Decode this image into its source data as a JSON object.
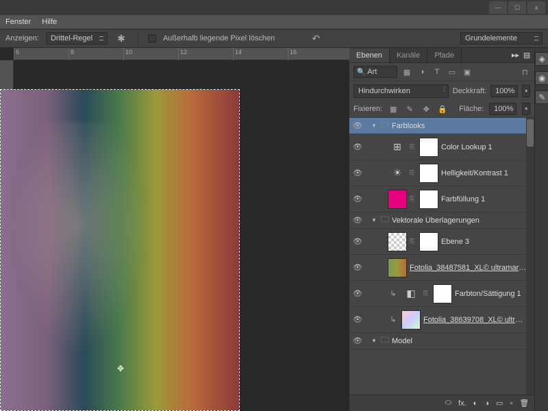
{
  "menubar": {
    "fenster": "Fenster",
    "hilfe": "Hilfe"
  },
  "winbtns": {
    "min": "—",
    "max": "☐",
    "close": "x"
  },
  "optbar": {
    "anzeigen_label": "Anzeigen:",
    "anzeigen_value": "Drittel-Regel",
    "checkbox_label": "Außerhalb liegende Pixel löschen",
    "workspace_dd": "Grundelemente"
  },
  "ruler": {
    "ticks": [
      "6",
      "8",
      "10",
      "12",
      "14",
      "16"
    ]
  },
  "panels": {
    "tabs": {
      "ebenen": "Ebenen",
      "kanaele": "Kanäle",
      "pfade": "Pfade"
    },
    "search": "Art",
    "blend_mode": "Hindurchwirken",
    "deckkraft_label": "Deckkraft:",
    "deckkraft_value": "100%",
    "fixieren_label": "Fixieren:",
    "flaeche_label": "Fläche:",
    "flaeche_value": "100%"
  },
  "groups": {
    "farblooks": "Farblooks",
    "vektorale": "Vektorale Überlagerungen",
    "model": "Model"
  },
  "layers": {
    "color_lookup": "Color Lookup 1",
    "hellkontrast": "Helligkeit/Kontrast 1",
    "farbfuellung": "Farbfüllung 1",
    "ebene3": "Ebene 3",
    "fotolia1": "Fotolia_38487581_XL© ultramari...",
    "farbton": "Farbton/Sättigung 1",
    "fotolia2": "Fotolia_38639708_XL© ultramari..."
  },
  "footer_icons": {
    "link": "⬭",
    "fx": "fx.",
    "mask": "◐",
    "adj": "◑",
    "group": "▭",
    "new": "▫",
    "trash": "🗑"
  }
}
